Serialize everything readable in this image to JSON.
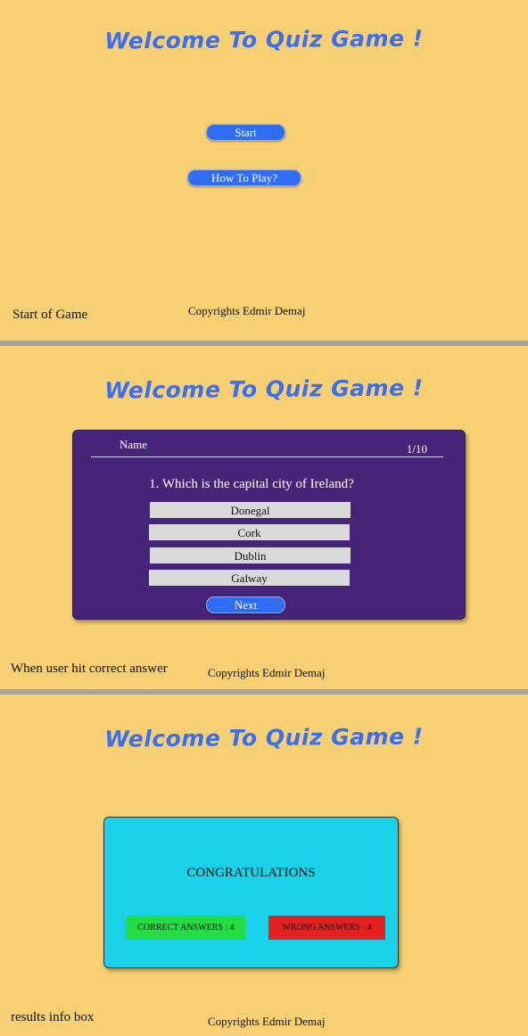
{
  "title": "Welcome To Quiz Game !",
  "start_screen": {
    "start_label": "Start",
    "howto_label": "How To Play?",
    "caption": "Start of Game",
    "copyright": "Copyrights Edmir Demaj"
  },
  "quiz_screen": {
    "name_label": "Name",
    "counter": "1/10",
    "question": "1. Which is the capital city of Ireland?",
    "options": [
      "Donegal",
      "Cork",
      "Dublin",
      "Galway"
    ],
    "next_label": "Next",
    "caption": "When user hit correct answer",
    "copyright": "Copyrights Edmir Demaj"
  },
  "result_screen": {
    "congrats": "CONGRATULATIONS",
    "correct_label": "CORRECT ANSWERS : 4",
    "wrong_label": "WRONG ANSWERS : 4",
    "caption": "results info box",
    "copyright": "Copyrights Edmir Demaj"
  },
  "colors": {
    "background": "#f7d073",
    "title": "#3b6ff2",
    "button": "#2f6df5",
    "quiz_box": "#45247a",
    "result_box": "#19d2e8",
    "correct": "#22dd44",
    "wrong": "#e52020",
    "divider": "#a6a29a"
  }
}
